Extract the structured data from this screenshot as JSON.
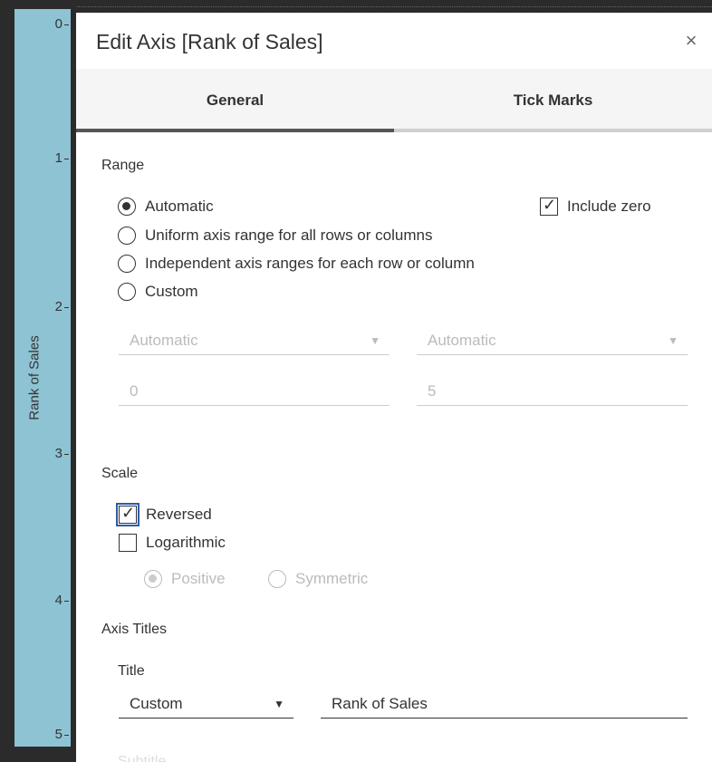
{
  "axis": {
    "title": "Rank of Sales",
    "ticks": [
      "0",
      "1",
      "2",
      "3",
      "4",
      "5"
    ]
  },
  "dialog": {
    "title": "Edit Axis [Rank of Sales]",
    "close_glyph": "×",
    "tabs": [
      {
        "label": "General",
        "active": true
      },
      {
        "label": "Tick Marks",
        "active": false
      }
    ]
  },
  "range": {
    "title": "Range",
    "options": [
      {
        "label": "Automatic",
        "selected": true
      },
      {
        "label": "Uniform axis range for all rows or columns",
        "selected": false
      },
      {
        "label": "Independent axis ranges for each row or column",
        "selected": false
      },
      {
        "label": "Custom",
        "selected": false
      }
    ],
    "include_zero_label": "Include zero",
    "include_zero_checked": true,
    "start_dropdown": "Automatic",
    "end_dropdown": "Automatic",
    "start_value": "0",
    "end_value": "5"
  },
  "scale": {
    "title": "Scale",
    "reversed_label": "Reversed",
    "reversed_checked": true,
    "logarithmic_label": "Logarithmic",
    "logarithmic_checked": false,
    "positive_label": "Positive",
    "symmetric_label": "Symmetric"
  },
  "axis_titles": {
    "title": "Axis Titles",
    "title_label": "Title",
    "title_mode": "Custom",
    "title_value": "Rank of Sales",
    "subtitle_label": "Subtitle"
  },
  "icons": {
    "close": "close-icon",
    "caret": "caret-down-icon",
    "check": "check-icon"
  },
  "colors": {
    "axis_band": "#8ec3d3",
    "focus_outline": "#2f5aa8",
    "active_tab_bar": "#555555"
  }
}
